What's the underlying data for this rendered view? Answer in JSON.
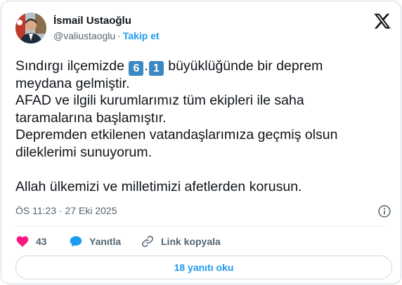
{
  "author": {
    "name": "İsmail Ustaoğlu",
    "handle": "@valiustaoglu",
    "separator": "·",
    "follow_label": "Takip et"
  },
  "tweet": {
    "line1_before": "Sındırgı ilçemizde ",
    "digit1": "6",
    "dot": ".",
    "digit2": "1",
    "line1_after": " büyüklüğünde bir deprem",
    "line2": "meydana gelmiştir.",
    "line3": "AFAD ve ilgili kurumlarımız tüm ekipleri ile saha",
    "line4": "taramalarına başlamıştır.",
    "line5": "Depremden etkilenen vatandaşlarımıza geçmiş olsun",
    "line6": "dileklerimi sunuyorum.",
    "line7": "Allah ülkemizi ve milletimizi afetlerden korusun."
  },
  "meta": {
    "timestamp": "ÖS 11:23 · 27 Eki 2025"
  },
  "actions": {
    "like_count": "43",
    "reply_label": "Yanıtla",
    "copy_link_label": "Link kopyala"
  },
  "footer": {
    "read_replies_label": "18 yanıtı oku"
  },
  "colors": {
    "accent": "#1d9bf0",
    "like": "#f91880",
    "text": "#0f1419",
    "muted": "#536471",
    "keycap": "#3b88c3"
  },
  "icons": {
    "brand": "x-logo-icon",
    "like": "heart-icon",
    "reply": "speech-bubble-icon",
    "copy": "link-icon",
    "info": "info-icon"
  }
}
